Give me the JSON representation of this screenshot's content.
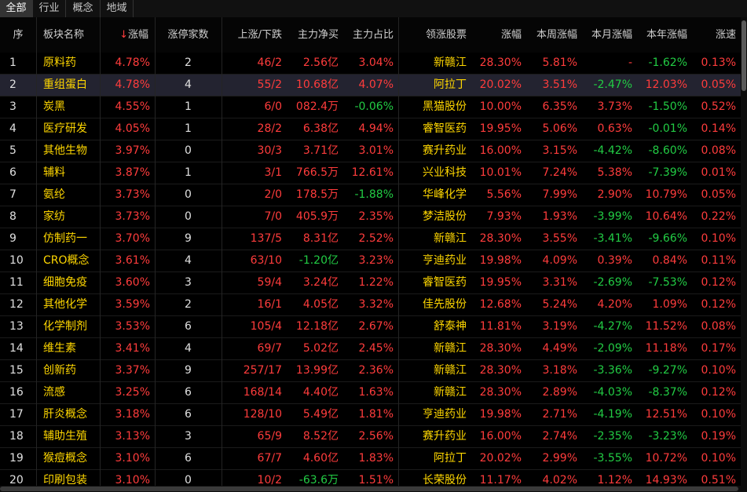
{
  "tabs": [
    "全部",
    "行业",
    "概念",
    "地域"
  ],
  "active_tab": 0,
  "headers": {
    "idx": "序",
    "name": "板块名称",
    "sort_marker": "↓",
    "pct": "涨幅",
    "limitup": "涨停家数",
    "updown": "上涨/下跌",
    "netbuy": "主力净买",
    "share": "主力占比",
    "leader": "领涨股票",
    "leader_pct": "涨幅",
    "week": "本周涨幅",
    "month": "本月涨幅",
    "year": "本年涨幅",
    "speed": "涨速"
  },
  "colors": {
    "up": "#ff3c3c",
    "down": "#22cc44",
    "name": "#ffd700",
    "neutral": "#e0e0e0",
    "selected_bg": "#232330"
  },
  "selected_row": 1,
  "rows": [
    {
      "idx": "1",
      "name": "原料药",
      "pct": "4.78%",
      "limitup": "2",
      "updown": "46/2",
      "netbuy": "2.56亿",
      "share": "3.04%",
      "leader": "新赣江",
      "leader_pct": "28.30%",
      "week": "5.81%",
      "month": "-",
      "year": "-1.62%",
      "speed": "0.13%"
    },
    {
      "idx": "2",
      "name": "重组蛋白",
      "pct": "4.78%",
      "limitup": "4",
      "updown": "55/2",
      "netbuy": "10.68亿",
      "share": "4.07%",
      "leader": "阿拉丁",
      "leader_pct": "20.02%",
      "week": "3.51%",
      "month": "-2.47%",
      "year": "12.03%",
      "speed": "0.05%"
    },
    {
      "idx": "3",
      "name": "炭黑",
      "pct": "4.55%",
      "limitup": "1",
      "updown": "6/0",
      "netbuy": "082.4万",
      "share": "-0.06%",
      "leader": "黑猫股份",
      "leader_pct": "10.00%",
      "week": "6.35%",
      "month": "3.73%",
      "year": "-1.50%",
      "speed": "0.52%"
    },
    {
      "idx": "4",
      "name": "医疗研发",
      "pct": "4.05%",
      "limitup": "1",
      "updown": "28/2",
      "netbuy": "6.38亿",
      "share": "4.94%",
      "leader": "睿智医药",
      "leader_pct": "19.95%",
      "week": "5.06%",
      "month": "0.63%",
      "year": "-0.01%",
      "speed": "0.14%"
    },
    {
      "idx": "5",
      "name": "其他生物",
      "pct": "3.97%",
      "limitup": "0",
      "updown": "30/3",
      "netbuy": "3.71亿",
      "share": "3.01%",
      "leader": "赛升药业",
      "leader_pct": "16.00%",
      "week": "3.15%",
      "month": "-4.42%",
      "year": "-8.60%",
      "speed": "0.08%"
    },
    {
      "idx": "6",
      "name": "辅料",
      "pct": "3.87%",
      "limitup": "1",
      "updown": "3/1",
      "netbuy": "766.5万",
      "share": "12.61%",
      "leader": "兴业科技",
      "leader_pct": "10.01%",
      "week": "7.24%",
      "month": "5.38%",
      "year": "-7.39%",
      "speed": "0.01%"
    },
    {
      "idx": "7",
      "name": "氨纶",
      "pct": "3.73%",
      "limitup": "0",
      "updown": "2/0",
      "netbuy": "178.5万",
      "share": "-1.88%",
      "leader": "华峰化学",
      "leader_pct": "5.56%",
      "week": "7.99%",
      "month": "2.90%",
      "year": "10.79%",
      "speed": "0.05%"
    },
    {
      "idx": "8",
      "name": "家纺",
      "pct": "3.73%",
      "limitup": "0",
      "updown": "7/0",
      "netbuy": "405.9万",
      "share": "2.35%",
      "leader": "梦洁股份",
      "leader_pct": "7.93%",
      "week": "1.93%",
      "month": "-3.99%",
      "year": "10.64%",
      "speed": "0.22%"
    },
    {
      "idx": "9",
      "name": "仿制药一",
      "pct": "3.70%",
      "limitup": "9",
      "updown": "137/5",
      "netbuy": "8.31亿",
      "share": "2.52%",
      "leader": "新赣江",
      "leader_pct": "28.30%",
      "week": "3.55%",
      "month": "-3.41%",
      "year": "-9.66%",
      "speed": "0.10%"
    },
    {
      "idx": "10",
      "name": "CRO概念",
      "pct": "3.61%",
      "limitup": "4",
      "updown": "63/10",
      "netbuy": "-1.20亿",
      "share": "3.23%",
      "leader": "亨迪药业",
      "leader_pct": "19.98%",
      "week": "4.09%",
      "month": "0.39%",
      "year": "0.84%",
      "speed": "0.11%"
    },
    {
      "idx": "11",
      "name": "细胞免疫",
      "pct": "3.60%",
      "limitup": "3",
      "updown": "59/4",
      "netbuy": "3.24亿",
      "share": "1.22%",
      "leader": "睿智医药",
      "leader_pct": "19.95%",
      "week": "3.31%",
      "month": "-2.69%",
      "year": "-7.53%",
      "speed": "0.12%"
    },
    {
      "idx": "12",
      "name": "其他化学",
      "pct": "3.59%",
      "limitup": "2",
      "updown": "16/1",
      "netbuy": "4.05亿",
      "share": "3.32%",
      "leader": "佳先股份",
      "leader_pct": "12.68%",
      "week": "5.24%",
      "month": "4.20%",
      "year": "1.09%",
      "speed": "0.12%"
    },
    {
      "idx": "13",
      "name": "化学制剂",
      "pct": "3.53%",
      "limitup": "6",
      "updown": "105/4",
      "netbuy": "12.18亿",
      "share": "2.67%",
      "leader": "舒泰神",
      "leader_pct": "11.81%",
      "week": "3.19%",
      "month": "-4.27%",
      "year": "11.52%",
      "speed": "0.08%"
    },
    {
      "idx": "14",
      "name": "维生素",
      "pct": "3.41%",
      "limitup": "4",
      "updown": "69/7",
      "netbuy": "5.02亿",
      "share": "2.45%",
      "leader": "新赣江",
      "leader_pct": "28.30%",
      "week": "4.49%",
      "month": "-2.09%",
      "year": "11.18%",
      "speed": "0.17%"
    },
    {
      "idx": "15",
      "name": "创新药",
      "pct": "3.37%",
      "limitup": "9",
      "updown": "257/17",
      "netbuy": "13.99亿",
      "share": "2.36%",
      "leader": "新赣江",
      "leader_pct": "28.30%",
      "week": "3.18%",
      "month": "-3.36%",
      "year": "-9.27%",
      "speed": "0.10%"
    },
    {
      "idx": "16",
      "name": "流感",
      "pct": "3.25%",
      "limitup": "6",
      "updown": "168/14",
      "netbuy": "4.40亿",
      "share": "1.63%",
      "leader": "新赣江",
      "leader_pct": "28.30%",
      "week": "2.89%",
      "month": "-4.03%",
      "year": "-8.37%",
      "speed": "0.12%"
    },
    {
      "idx": "17",
      "name": "肝炎概念",
      "pct": "3.18%",
      "limitup": "6",
      "updown": "128/10",
      "netbuy": "5.49亿",
      "share": "1.81%",
      "leader": "亨迪药业",
      "leader_pct": "19.98%",
      "week": "2.71%",
      "month": "-4.19%",
      "year": "12.51%",
      "speed": "0.10%"
    },
    {
      "idx": "18",
      "name": "辅助生殖",
      "pct": "3.13%",
      "limitup": "3",
      "updown": "65/9",
      "netbuy": "8.52亿",
      "share": "2.56%",
      "leader": "赛升药业",
      "leader_pct": "16.00%",
      "week": "2.74%",
      "month": "-2.35%",
      "year": "-3.23%",
      "speed": "0.19%"
    },
    {
      "idx": "19",
      "name": "猴痘概念",
      "pct": "3.10%",
      "limitup": "6",
      "updown": "67/7",
      "netbuy": "4.60亿",
      "share": "1.83%",
      "leader": "阿拉丁",
      "leader_pct": "20.02%",
      "week": "2.99%",
      "month": "-3.55%",
      "year": "10.72%",
      "speed": "0.10%"
    },
    {
      "idx": "20",
      "name": "印刷包装",
      "pct": "3.10%",
      "limitup": "0",
      "updown": "10/2",
      "netbuy": "-63.6万",
      "share": "1.51%",
      "leader": "长荣股份",
      "leader_pct": "11.17%",
      "week": "4.02%",
      "month": "1.12%",
      "year": "14.93%",
      "speed": "0.51%"
    }
  ]
}
